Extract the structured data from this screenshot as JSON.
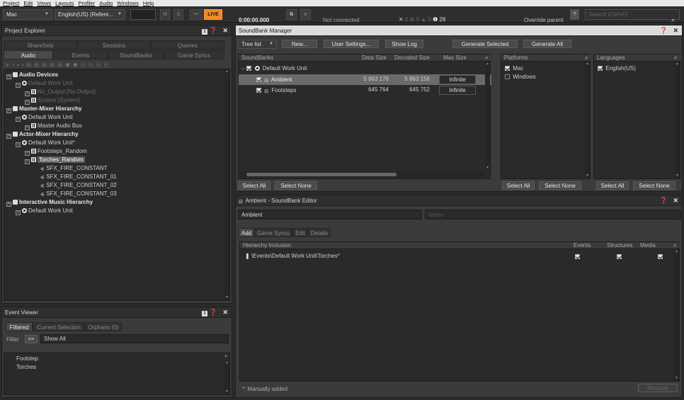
{
  "menu": [
    "Project",
    "Edit",
    "Views",
    "Layouts",
    "Profiler",
    "Audio",
    "Windows",
    "Help"
  ],
  "toolbar": {
    "platform": "Mac",
    "language": "English(US) (Refere...",
    "m_btn": "M",
    "s_btn": "S",
    "live": "LIVE",
    "timecode": "0:00:00.000",
    "connection": "Not connected",
    "status_x": "0",
    "status_err": "0",
    "status_warn": "0",
    "status_info": "26",
    "override_parent": "Override parent",
    "help": "?",
    "search_placeholder": "Search (Ctrl+F)"
  },
  "project_explorer": {
    "title": "Project Explorer",
    "tabs_top": [
      "ShareSets",
      "Sessions",
      "Queries"
    ],
    "tabs_bottom": [
      "Audio",
      "Events",
      "SoundBanks",
      "Game Syncs"
    ],
    "tree": [
      {
        "label": "Audio Devices",
        "level": 0,
        "bold": true
      },
      {
        "label": "Default Work Unit",
        "level": 1,
        "dim": true
      },
      {
        "label": "No_Output [No Output]",
        "level": 2,
        "dim": true
      },
      {
        "label": "System [System]",
        "level": 2,
        "dim": true
      },
      {
        "label": "Master-Mixer Hierarchy",
        "level": 0,
        "bold": true
      },
      {
        "label": "Default Work Unit",
        "level": 1
      },
      {
        "label": "Master Audio Bus",
        "level": 2
      },
      {
        "label": "Actor-Mixer Hierarchy",
        "level": 0,
        "bold": true
      },
      {
        "label": "Default Work Unit*",
        "level": 1
      },
      {
        "label": "Footsteps_Random",
        "level": 2
      },
      {
        "label": "Torches_Random",
        "level": 2,
        "selected": true
      },
      {
        "label": "SFX_FIRE_CONSTANT",
        "level": 3
      },
      {
        "label": "SFX_FIRE_CONSTANT_01",
        "level": 3
      },
      {
        "label": "SFX_FIRE_CONSTANT_02",
        "level": 3
      },
      {
        "label": "SFX_FIRE_CONSTANT_03",
        "level": 3
      },
      {
        "label": "Interactive Music Hierarchy",
        "level": 0,
        "bold": true
      },
      {
        "label": "Default Work Unit",
        "level": 1
      }
    ]
  },
  "event_viewer": {
    "title": "Event Viewer",
    "tabs": [
      "Filtered",
      "Current Selection",
      "Orphans (0)"
    ],
    "filter_label": "Filter",
    "filter_btn": ">>",
    "filter_value": "Show All",
    "items": [
      "Footstep",
      "Torches"
    ]
  },
  "soundbank_manager": {
    "title": "SoundBank Manager",
    "view_mode": "Tree list",
    "new_btn": "New...",
    "user_settings_btn": "User Settings...",
    "show_log_btn": "Show Log",
    "gen_selected_btn": "Generate Selected",
    "gen_all_btn": "Generate All",
    "cols": [
      "SoundBanks",
      "Data Size",
      "Decoded Size",
      "Max Size"
    ],
    "root": "Default Work Unit",
    "banks": [
      {
        "name": "Ambient",
        "data": "5 863 176",
        "decoded": "5 863 156",
        "max": "Infinite"
      },
      {
        "name": "Footsteps",
        "data": "645 764",
        "decoded": "645 752",
        "max": "Infinite"
      }
    ],
    "platforms_title": "Platforms",
    "platforms": [
      {
        "name": "Mac",
        "checked": true
      },
      {
        "name": "Windows",
        "checked": false
      }
    ],
    "languages_title": "Languages",
    "languages": [
      {
        "name": "English(US)",
        "checked": true
      }
    ],
    "select_all": "Select All",
    "select_none": "Select None"
  },
  "soundbank_editor": {
    "title": "Ambient - SoundBank Editor",
    "name_value": "Ambient",
    "notes_placeholder": "Notes",
    "tabs": [
      "Add",
      "Game Syncs",
      "Edit",
      "Details"
    ],
    "cols": [
      "Hierarchy Inclusion",
      "Events",
      "Structures",
      "Media"
    ],
    "rows": [
      {
        "path": "\\Events\\Default Work Unit\\Torches*"
      }
    ],
    "footer_note": "*: Manually added",
    "remove_btn": "Remove"
  }
}
